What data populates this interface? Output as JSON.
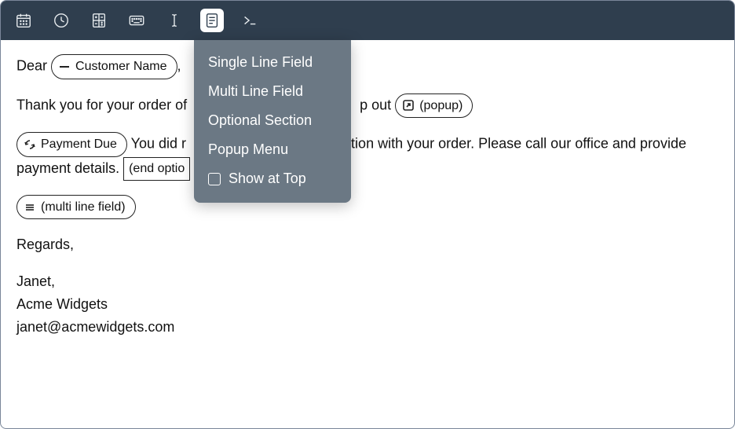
{
  "toolbar": {
    "icons": [
      "date-picker-icon",
      "clock-icon",
      "calculator-icon",
      "keyboard-icon",
      "text-cursor-icon",
      "form-icon",
      "terminal-icon"
    ],
    "active_index": 5
  },
  "dropdown": {
    "items": [
      {
        "label": "Single Line Field"
      },
      {
        "label": "Multi Line Field"
      },
      {
        "label": "Optional Section"
      },
      {
        "label": "Popup Menu"
      },
      {
        "label": "Show at Top",
        "checkbox": true
      }
    ]
  },
  "body": {
    "greeting_prefix": "Dear",
    "customer_name_field": "Customer Name",
    "greeting_suffix": ",",
    "thanks_line_before": "Thank you for your order of",
    "thanks_line_after": "p out",
    "popup_field_label": "(popup)",
    "payment_due_label": "Payment Due",
    "payment_sentence_before": "You did r",
    "payment_sentence_after": "nation with your order.  Please call our office and provide payment details.",
    "end_option_label": "(end optio",
    "multi_line_field_label": "(multi line field)",
    "regards": "Regards,",
    "signature_name": "Janet,",
    "signature_company": "Acme Widgets",
    "signature_email": "janet@acmewidgets.com"
  }
}
